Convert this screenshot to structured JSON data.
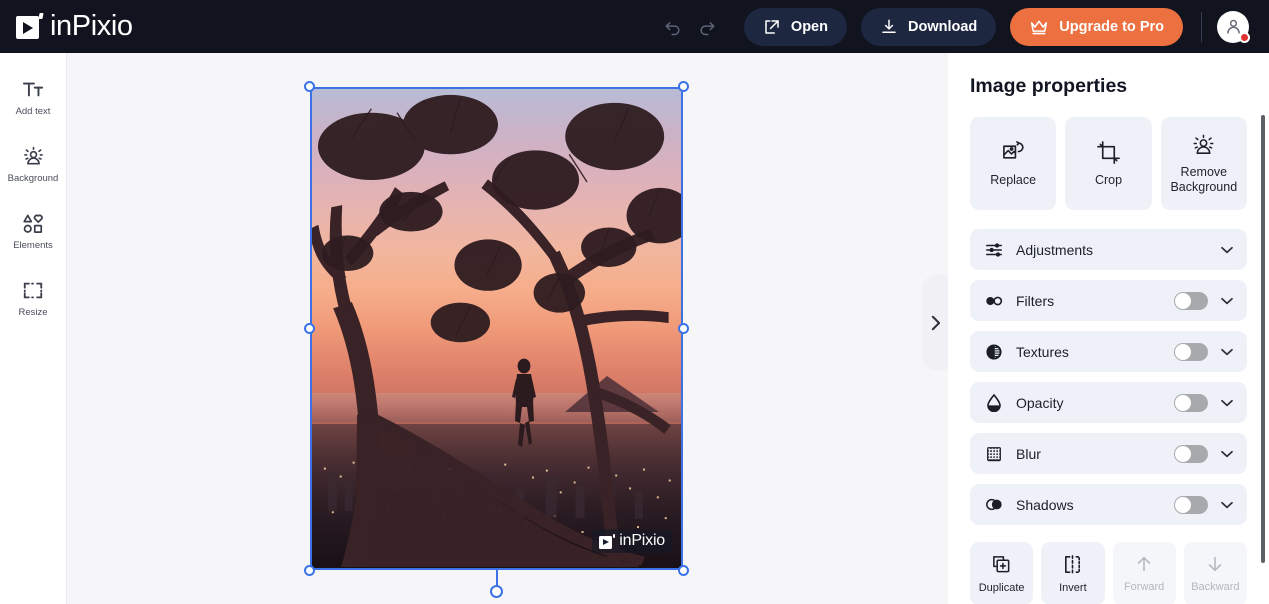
{
  "app": {
    "brand": "inPixio",
    "logo_icon": "inpixio-play-logo-icon"
  },
  "topbar": {
    "undo": {
      "label": "Undo",
      "icon": "undo-arrow-icon"
    },
    "redo": {
      "label": "Redo",
      "icon": "redo-arrow-icon"
    },
    "open": {
      "label": "Open",
      "icon": "external-link-icon"
    },
    "download": {
      "label": "Download",
      "icon": "download-arrow-icon"
    },
    "upgrade": {
      "label": "Upgrade to Pro",
      "icon": "crown-icon",
      "color": "#ec7040"
    },
    "avatar": {
      "icon": "user-avatar-icon",
      "badge": "notification-dot",
      "badge_color": "#e03131"
    },
    "background_color": "#11141f"
  },
  "sidebar": {
    "items": [
      {
        "label": "Add text",
        "icon": "text-tool-icon"
      },
      {
        "label": "Background",
        "icon": "background-remove-icon"
      },
      {
        "label": "Elements",
        "icon": "shapes-elements-icon"
      },
      {
        "label": "Resize",
        "icon": "resize-crop-icon"
      }
    ]
  },
  "canvas": {
    "background_color": "#f6f6f9",
    "collapse_tab_icon": "chevron-right-icon",
    "selection_color": "#3b72e8",
    "image": {
      "alt": "Person standing on a tree branch silhouetted against a sunset over a coastal city",
      "watermark": "inPixio",
      "watermark_icon": "inpixio-play-logo-icon",
      "handles": [
        "top-left",
        "top-right",
        "bottom-left",
        "bottom-right",
        "middle-left",
        "middle-right",
        "rotate"
      ]
    }
  },
  "properties": {
    "title": "Image properties",
    "tools": [
      {
        "label": "Replace",
        "icon": "image-replace-icon"
      },
      {
        "label": "Crop",
        "icon": "crop-icon"
      },
      {
        "label": "Remove Background",
        "icon": "background-remove-icon"
      }
    ],
    "rows": [
      {
        "label": "Adjustments",
        "icon": "sliders-icon",
        "has_toggle": false,
        "toggle_on": false,
        "chevron": "chevron-down-icon"
      },
      {
        "label": "Filters",
        "icon": "filters-circles-icon",
        "has_toggle": true,
        "toggle_on": false,
        "chevron": "chevron-down-icon"
      },
      {
        "label": "Textures",
        "icon": "texture-half-circle-icon",
        "has_toggle": true,
        "toggle_on": false,
        "chevron": "chevron-down-icon"
      },
      {
        "label": "Opacity",
        "icon": "opacity-droplet-icon",
        "has_toggle": true,
        "toggle_on": false,
        "chevron": "chevron-down-icon"
      },
      {
        "label": "Blur",
        "icon": "blur-grid-icon",
        "has_toggle": true,
        "toggle_on": false,
        "chevron": "chevron-down-icon"
      },
      {
        "label": "Shadows",
        "icon": "shadows-overlap-icon",
        "has_toggle": true,
        "toggle_on": false,
        "chevron": "chevron-down-icon"
      }
    ],
    "arrange": [
      {
        "label": "Duplicate",
        "icon": "duplicate-icon",
        "disabled": false
      },
      {
        "label": "Invert",
        "icon": "invert-flip-icon",
        "disabled": false
      },
      {
        "label": "Forward",
        "icon": "arrow-up-icon",
        "disabled": true
      },
      {
        "label": "Backward",
        "icon": "arrow-down-icon",
        "disabled": true
      }
    ]
  }
}
